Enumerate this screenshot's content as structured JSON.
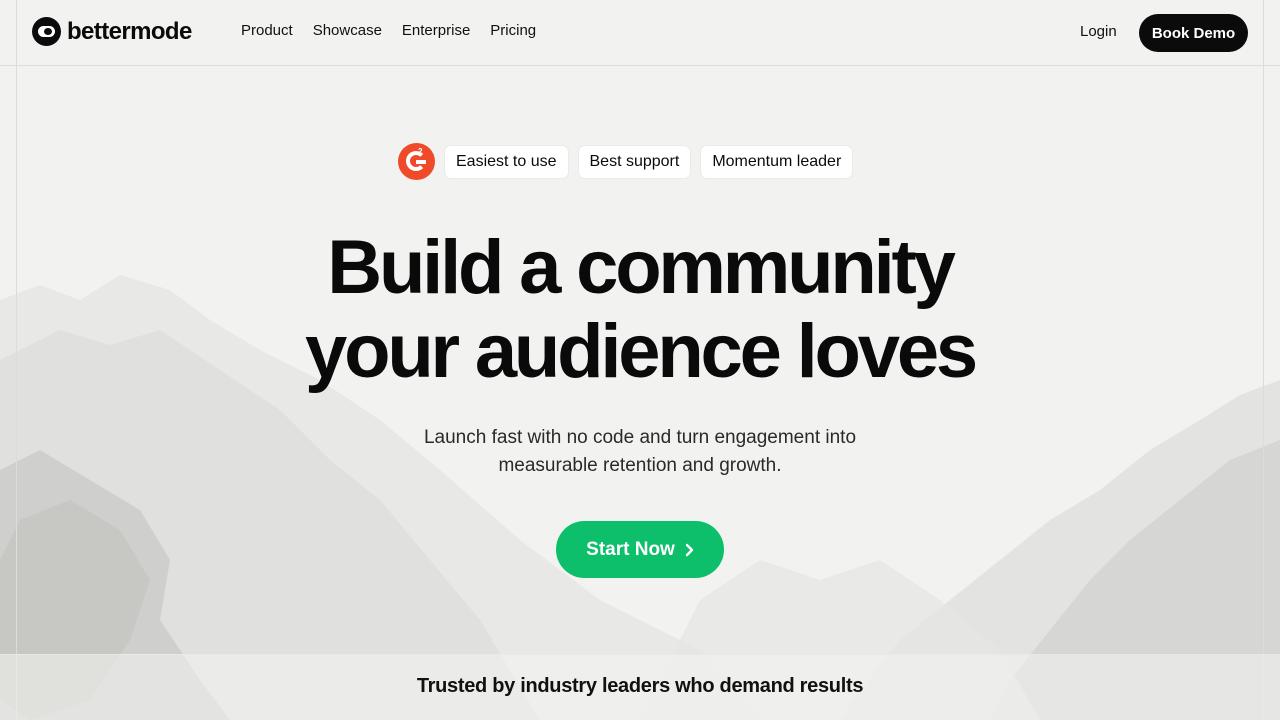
{
  "brand": {
    "name": "bettermode",
    "logo_icon": "toggle-logo-icon"
  },
  "nav": {
    "items": [
      {
        "label": "Product"
      },
      {
        "label": "Showcase"
      },
      {
        "label": "Enterprise"
      },
      {
        "label": "Pricing"
      }
    ],
    "login_label": "Login",
    "demo_label": "Book Demo"
  },
  "badges": {
    "g2_icon": "g2-logo-icon",
    "items": [
      {
        "label": "Easiest to use"
      },
      {
        "label": "Best support"
      },
      {
        "label": "Momentum leader"
      }
    ]
  },
  "hero": {
    "title_line1": "Build a community",
    "title_line2": "your audience loves",
    "subtitle_line1": "Launch fast with no code and turn engagement into",
    "subtitle_line2": "measurable retention and growth.",
    "cta_label": "Start Now",
    "cta_icon": "chevron-right-icon"
  },
  "trusted": {
    "text": "Trusted by industry leaders who demand results"
  },
  "colors": {
    "cta_green": "#0dbf6b",
    "g2_orange": "#ef4a2a",
    "ink": "#0b0b0b",
    "background": "#f3f3f2"
  }
}
